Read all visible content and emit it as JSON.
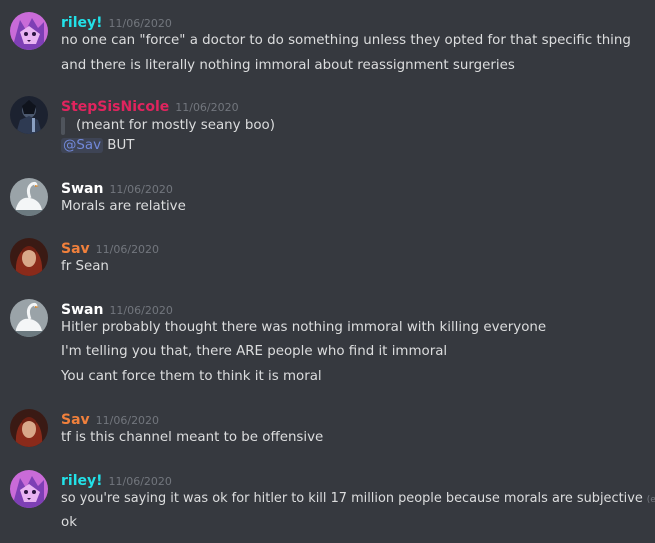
{
  "colors": {
    "background": "#36393f",
    "text": "#dcddde",
    "timestamp": "#72767d",
    "mention": "#7289da"
  },
  "messages": [
    {
      "user": "riley!",
      "color": "#22e1e8",
      "avatar_icon": "purple-wolf-avatar-icon",
      "timestamp": "11/06/2020",
      "lines": [
        "no one can \"force\" a doctor to do something unless they opted for that specific thing",
        "and there is literally nothing immoral about reassignment surgeries"
      ]
    },
    {
      "user": "StepSisNicole",
      "color": "#e0245e",
      "avatar_icon": "dark-figure-avatar-icon",
      "timestamp": "11/06/2020",
      "quote": "(meant for mostly seany boo)",
      "mention": "@Sav",
      "after_mention": "BUT"
    },
    {
      "user": "Swan",
      "color": "#ffffff",
      "avatar_icon": "white-swan-avatar-icon",
      "timestamp": "11/06/2020",
      "lines": [
        "Morals are relative"
      ]
    },
    {
      "user": "Sav",
      "color": "#f0803c",
      "avatar_icon": "red-hair-avatar-icon",
      "timestamp": "11/06/2020",
      "lines": [
        "fr Sean"
      ]
    },
    {
      "user": "Swan",
      "color": "#ffffff",
      "avatar_icon": "white-swan-avatar-icon",
      "timestamp": "11/06/2020",
      "lines": [
        "Hitler probably thought there was nothing immoral with killing everyone",
        "I'm telling you that, there ARE people who find it immoral",
        "You cant force them to think it is moral"
      ]
    },
    {
      "user": "Sav",
      "color": "#f0803c",
      "avatar_icon": "red-hair-avatar-icon",
      "timestamp": "11/06/2020",
      "lines": [
        "tf is this channel meant to be offensive"
      ]
    },
    {
      "user": "riley!",
      "color": "#22e1e8",
      "avatar_icon": "purple-wolf-avatar-icon",
      "timestamp": "11/06/2020",
      "lines": [
        "so you're saying it was ok for hitler to kill 17 million people because morals are subjective",
        "ok"
      ],
      "edited_label": "(edited)"
    }
  ]
}
